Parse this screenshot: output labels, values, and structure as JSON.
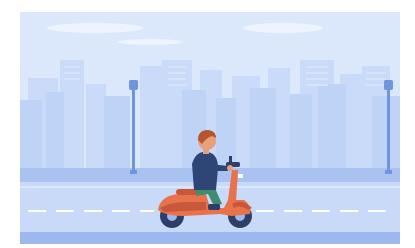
{
  "scene": {
    "description_free_art": true,
    "palette": {
      "sky": "#dbe7fb",
      "cloud": "#eef4fe",
      "buildings_back": "#c4d7f7",
      "buildings_front": "#b7cdf5",
      "street_lamp": "#6e95dd",
      "sidewalk": "#a9c2f1",
      "road": "#c8daf8",
      "road_edge": "#9bb8ef",
      "lane_mark": "#ffffff",
      "scooter": "#e8734b",
      "scooter_dark": "#c9583a",
      "wheel": "#2d3f66",
      "rider_shirt": "#2e4676",
      "rider_pants": "#3f8c6e",
      "rider_skin": "#e6a07d",
      "rider_hair": "#b8532d"
    },
    "icons": [
      "street-lamp-icon",
      "scooter-icon",
      "rider-icon",
      "cloud-icon",
      "city-skyline-icon"
    ]
  }
}
